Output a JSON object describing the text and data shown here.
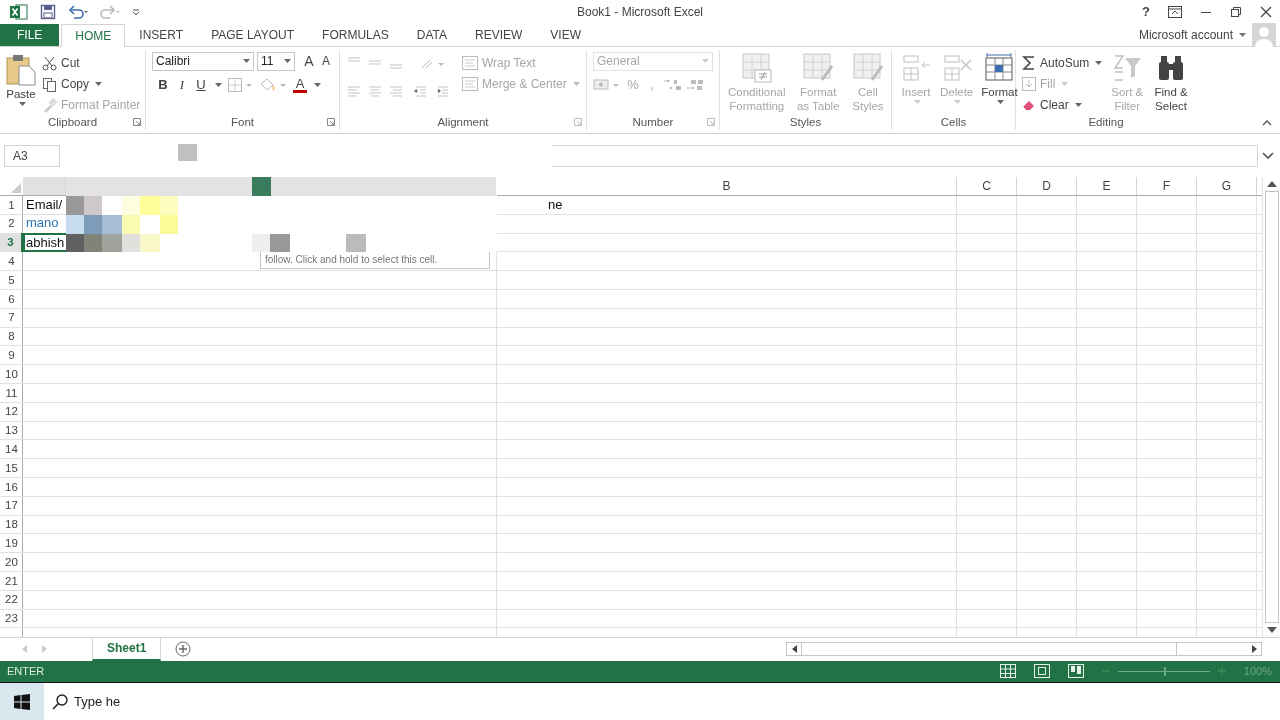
{
  "window": {
    "title": "Book1 - Microsoft Excel",
    "help": "?",
    "account": "Microsoft account"
  },
  "tabs": [
    {
      "label": "FILE",
      "kind": "file",
      "selected": false
    },
    {
      "label": "HOME",
      "kind": "tab",
      "selected": true
    },
    {
      "label": "INSERT",
      "kind": "tab",
      "selected": false
    },
    {
      "label": "PAGE LAYOUT",
      "kind": "tab",
      "selected": false
    },
    {
      "label": "FORMULAS",
      "kind": "tab",
      "selected": false
    },
    {
      "label": "DATA",
      "kind": "tab",
      "selected": false
    },
    {
      "label": "REVIEW",
      "kind": "tab",
      "selected": false
    },
    {
      "label": "VIEW",
      "kind": "tab",
      "selected": false
    }
  ],
  "ribbon": {
    "clipboard": {
      "label": "Clipboard",
      "paste": {
        "label": "Paste",
        "disabled": false
      },
      "actions": [
        {
          "label": "Cut",
          "disabled": false
        },
        {
          "label": "Copy",
          "disabled": false
        },
        {
          "label": "Format Painter",
          "disabled": true
        }
      ]
    },
    "font": {
      "label": "Font",
      "family": "Calibri",
      "size": "11",
      "size_buttons": [
        "A",
        "A"
      ],
      "styles": [
        "B",
        "I",
        "U"
      ],
      "color_button": "A"
    },
    "alignment": {
      "label": "Alignment",
      "actions": [
        {
          "label": "Wrap Text",
          "disabled": true
        },
        {
          "label": "Merge & Center",
          "disabled": true
        }
      ]
    },
    "number": {
      "label": "Number",
      "format": "General",
      "disabled": true,
      "symbols": [
        "%",
        ","
      ]
    },
    "styles": {
      "label": "Styles",
      "actions": [
        {
          "label": "Conditional Formatting",
          "disabled": true
        },
        {
          "label": "Format as Table",
          "disabled": true
        },
        {
          "label": "Cell Styles",
          "disabled": true
        }
      ]
    },
    "cells": {
      "label": "Cells",
      "actions": [
        {
          "label": "Insert",
          "disabled": true
        },
        {
          "label": "Delete",
          "disabled": true
        },
        {
          "label": "Format",
          "disabled": false
        }
      ]
    },
    "editing": {
      "label": "Editing",
      "actions": [
        {
          "label": "AutoSum",
          "disabled": false
        },
        {
          "label": "Fill",
          "disabled": true
        },
        {
          "label": "Clear",
          "disabled": false
        }
      ],
      "large": [
        {
          "label": "Sort & Filter",
          "disabled": true
        },
        {
          "label": "Find & Select",
          "disabled": false
        }
      ]
    }
  },
  "formula_bar": {
    "name_box": "A3"
  },
  "columns": [
    {
      "label": "B"
    },
    {
      "label": "C"
    },
    {
      "label": "D"
    },
    {
      "label": "E"
    },
    {
      "label": "F"
    },
    {
      "label": "G"
    }
  ],
  "rows": [
    {
      "label": "1",
      "selected": false,
      "cells": [
        {
          "text": "Email/",
          "kind": "text"
        },
        {
          "text": "ne",
          "kind": "text"
        }
      ]
    },
    {
      "label": "2",
      "selected": false,
      "cells": [
        {
          "text": "mano",
          "kind": "link"
        }
      ]
    },
    {
      "label": "3",
      "selected": true,
      "cells": [
        {
          "text": "abhish",
          "kind": "text"
        }
      ]
    },
    {
      "label": "4",
      "selected": false,
      "cells": []
    },
    {
      "label": "5",
      "selected": false,
      "cells": []
    },
    {
      "label": "6",
      "selected": false,
      "cells": []
    },
    {
      "label": "7",
      "selected": false,
      "cells": []
    },
    {
      "label": "8",
      "selected": false,
      "cells": []
    },
    {
      "label": "9",
      "selected": false,
      "cells": []
    },
    {
      "label": "10",
      "selected": false,
      "cells": []
    },
    {
      "label": "11",
      "selected": false,
      "cells": []
    },
    {
      "label": "12",
      "selected": false,
      "cells": []
    },
    {
      "label": "13",
      "selected": false,
      "cells": []
    },
    {
      "label": "14",
      "selected": false,
      "cells": []
    },
    {
      "label": "15",
      "selected": false,
      "cells": []
    },
    {
      "label": "16",
      "selected": false,
      "cells": []
    },
    {
      "label": "17",
      "selected": false,
      "cells": []
    },
    {
      "label": "18",
      "selected": false,
      "cells": []
    },
    {
      "label": "19",
      "selected": false,
      "cells": []
    },
    {
      "label": "20",
      "selected": false,
      "cells": []
    },
    {
      "label": "21",
      "selected": false,
      "cells": []
    },
    {
      "label": "22",
      "selected": false,
      "cells": []
    },
    {
      "label": "23",
      "selected": false,
      "cells": []
    }
  ],
  "tooltip": "follow. Click and hold to select this cell.",
  "sheets": [
    {
      "label": "Sheet1",
      "selected": true
    }
  ],
  "status_bar": {
    "mode": "ENTER",
    "zoom": {
      "level": 0.5,
      "reading": "100%"
    }
  },
  "taskbar": {
    "search": {
      "placeholder": "Type he"
    }
  }
}
